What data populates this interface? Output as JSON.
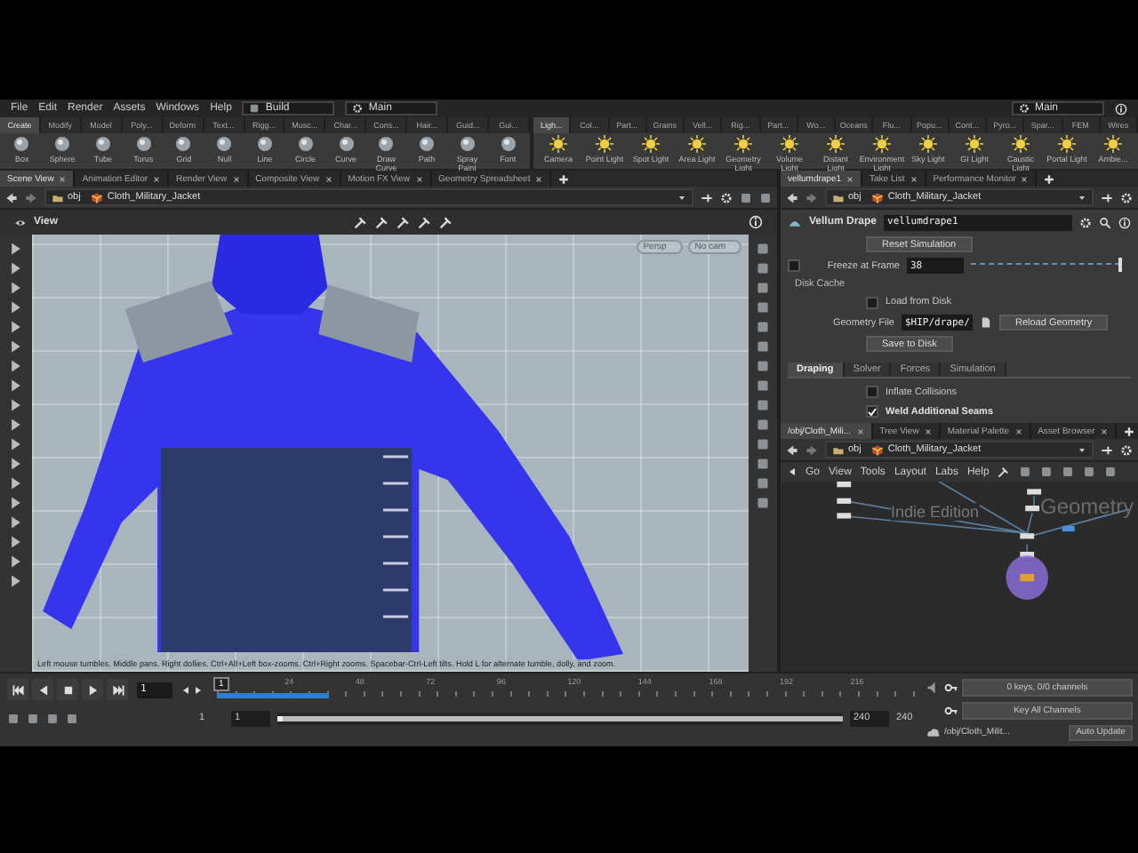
{
  "menu_bar": {
    "items": [
      "File",
      "Edit",
      "Render",
      "Assets",
      "Windows",
      "Help"
    ],
    "desktop": "Build",
    "left_shelf_set": "Main",
    "right_shelf_set": "Main"
  },
  "shelves": [
    {
      "tabs": [
        {
          "label": "Create",
          "selected": true
        },
        {
          "label": "Modify",
          "selected": false
        },
        {
          "label": "Model",
          "selected": false
        },
        {
          "label": "Poly...",
          "selected": false
        },
        {
          "label": "Deform",
          "selected": false
        },
        {
          "label": "Text...",
          "selected": false
        },
        {
          "label": "Rigg...",
          "selected": false
        },
        {
          "label": "Musc...",
          "selected": false
        },
        {
          "label": "Char...",
          "selected": false
        },
        {
          "label": "Cons...",
          "selected": false
        },
        {
          "label": "Hair...",
          "selected": false
        },
        {
          "label": "Guid...",
          "selected": false
        },
        {
          "label": "Gui...",
          "selected": false
        }
      ],
      "tools": [
        "Box",
        "Sphere",
        "Tube",
        "Torus",
        "Grid",
        "Null",
        "Line",
        "Circle",
        "Curve",
        "Draw Curve",
        "Path",
        "Spray Paint",
        "Font"
      ]
    },
    {
      "tabs": [
        {
          "label": "Ligh...",
          "selected": true
        },
        {
          "label": "Col...",
          "selected": false
        },
        {
          "label": "Part...",
          "selected": false
        },
        {
          "label": "Grains",
          "selected": false
        },
        {
          "label": "Vell...",
          "selected": false
        },
        {
          "label": "Rig...",
          "selected": false
        },
        {
          "label": "Part...",
          "selected": false
        },
        {
          "label": "Wo...",
          "selected": false
        },
        {
          "label": "Oceans",
          "selected": false
        },
        {
          "label": "Flu...",
          "selected": false
        },
        {
          "label": "Popu...",
          "selected": false
        },
        {
          "label": "Cont...",
          "selected": false
        },
        {
          "label": "Pyro...",
          "selected": false
        },
        {
          "label": "Spar...",
          "selected": false
        },
        {
          "label": "FEM",
          "selected": false
        },
        {
          "label": "Wires",
          "selected": false
        }
      ],
      "tools": [
        "Camera",
        "Point Light",
        "Spot Light",
        "Area Light",
        "Geometry Light",
        "Volume Light",
        "Distant Light",
        "Environment Light",
        "Sky Light",
        "GI Light",
        "Caustic Light",
        "Portal Light",
        "Ambie..."
      ]
    }
  ],
  "scene_pane": {
    "tabs": [
      {
        "label": "Scene View",
        "selected": true
      },
      {
        "label": "Animation Editor",
        "selected": false
      },
      {
        "label": "Render View",
        "selected": false
      },
      {
        "label": "Composite View",
        "selected": false
      },
      {
        "label": "Motion FX View",
        "selected": false
      },
      {
        "label": "Geometry Spreadsheet",
        "selected": false
      }
    ],
    "path": [
      "obj",
      "Cloth_Military_Jacket"
    ],
    "view_label": "View",
    "viewport": {
      "projection": "Persp",
      "camera": "No cam",
      "hint": "Left mouse tumbles. Middle pans. Right dollies. Ctrl+Alt+Left box-zooms. Ctrl+Right zooms. Spacebar-Ctrl-Left tilts. Hold L for alternate tumble, dolly, and zoom."
    }
  },
  "parameter_pane": {
    "tabs": [
      {
        "label": "vellumdrape1",
        "selected": true
      },
      {
        "label": "Take List",
        "selected": false
      },
      {
        "label": "Performance Monitor",
        "selected": false
      }
    ],
    "path": [
      "obj",
      "Cloth_Military_Jacket"
    ],
    "node_type": "Vellum Drape",
    "node_name": "vellumdrape1",
    "reset_button": "Reset Simulation",
    "freeze": {
      "label": "Freeze at Frame",
      "checked": false,
      "value": "38",
      "level": 1
    },
    "disk_cache": {
      "title": "Disk Cache",
      "load": {
        "label": "Load from Disk",
        "checked": false
      },
      "file_label": "Geometry File",
      "file_value": "$HIP/drape/",
      "reload_button": "Reload Geometry",
      "save_button": "Save to Disk"
    },
    "folder_tabs": [
      {
        "label": "Draping",
        "selected": true
      },
      {
        "label": "Solver",
        "selected": false
      },
      {
        "label": "Forces",
        "selected": false
      },
      {
        "label": "Simulation",
        "selected": false
      }
    ],
    "options": [
      {
        "label": "Inflate Collisions",
        "checked": false
      },
      {
        "label": "Weld Additional Seams",
        "checked": true
      }
    ]
  },
  "network_pane": {
    "tabs": [
      {
        "label": "/obj/Cloth_Mili...",
        "selected": true
      },
      {
        "label": "Tree View",
        "selected": false
      },
      {
        "label": "Material Palette",
        "selected": false
      },
      {
        "label": "Asset Browser",
        "selected": false
      }
    ],
    "path": [
      "obj",
      "Cloth_Military_Jacket"
    ],
    "menu": [
      "Go",
      "View",
      "Tools",
      "Layout",
      "Labs",
      "Help"
    ],
    "edition": "Indie Edition",
    "context": "Geometry"
  },
  "timeline": {
    "frame": "1",
    "current": "1",
    "ticks": [
      "24",
      "48",
      "72",
      "96",
      "120",
      "144",
      "168",
      "192",
      "216"
    ],
    "cached": {
      "level": 0.16
    },
    "range": {
      "start": "1",
      "view_start": "1",
      "view_end": "240",
      "end": "240",
      "level": 1
    }
  },
  "keys": {
    "status": "0 keys, 0/0 channels",
    "key_all": "Key All Channels"
  },
  "status_bar": {
    "path": "/obj/Cloth_Milit...",
    "update_mode": "Auto Update"
  }
}
